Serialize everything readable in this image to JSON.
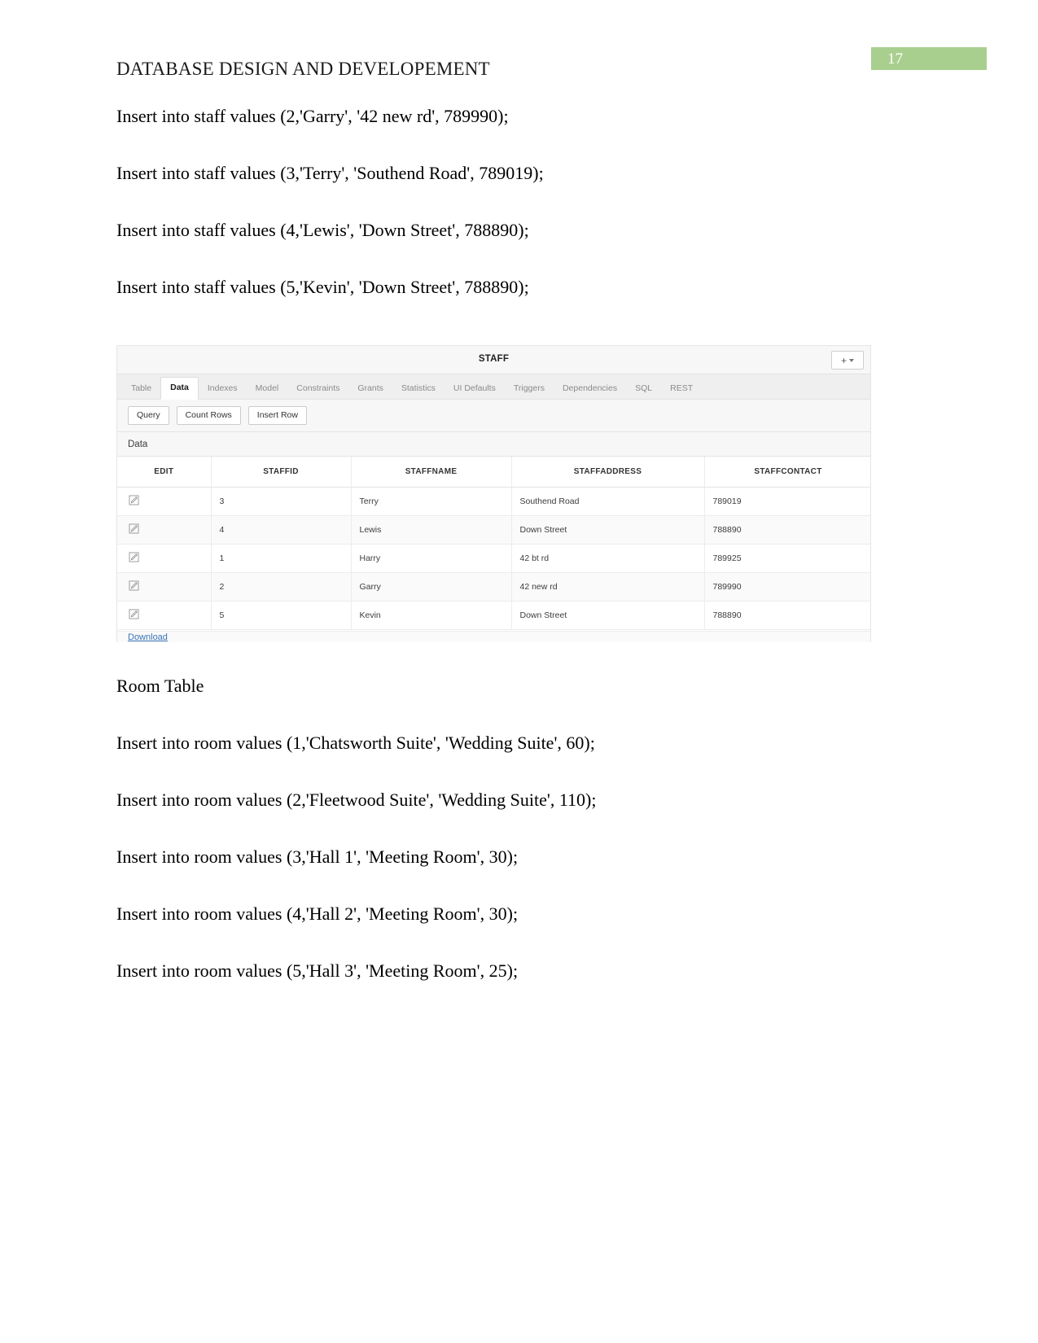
{
  "header": {
    "title": "DATABASE DESIGN AND DEVELOPEMENT",
    "page_number": "17",
    "badge_color": "#a9cf8f"
  },
  "body": {
    "staff_inserts": [
      "Insert into staff values (2,'Garry', '42 new rd', 789990);",
      "Insert into staff values (3,'Terry', 'Southend Road', 789019);",
      "Insert into staff values (4,'Lewis', 'Down Street', 788890);",
      "Insert into staff values (5,'Kevin', 'Down Street', 788890);"
    ],
    "room_heading": "Room Table",
    "room_inserts": [
      "Insert into room values (1,'Chatsworth Suite', 'Wedding Suite', 60);",
      "Insert into room values (2,'Fleetwood Suite', 'Wedding Suite', 110);",
      "Insert into room values (3,'Hall 1', 'Meeting Room', 30);",
      "Insert into room values (4,'Hall 2', 'Meeting Room', 30);",
      "Insert into room values (5,'Hall 3', 'Meeting Room', 25);"
    ]
  },
  "apex": {
    "title": "STAFF",
    "add_button_label": "+",
    "tabs": [
      {
        "label": "Table",
        "active": false
      },
      {
        "label": "Data",
        "active": true
      },
      {
        "label": "Indexes",
        "active": false
      },
      {
        "label": "Model",
        "active": false
      },
      {
        "label": "Constraints",
        "active": false
      },
      {
        "label": "Grants",
        "active": false
      },
      {
        "label": "Statistics",
        "active": false
      },
      {
        "label": "UI Defaults",
        "active": false
      },
      {
        "label": "Triggers",
        "active": false
      },
      {
        "label": "Dependencies",
        "active": false
      },
      {
        "label": "SQL",
        "active": false
      },
      {
        "label": "REST",
        "active": false
      }
    ],
    "buttons": [
      "Query",
      "Count Rows",
      "Insert Row"
    ],
    "section_label": "Data",
    "columns": [
      "EDIT",
      "STAFFID",
      "STAFFNAME",
      "STAFFADDRESS",
      "STAFFCONTACT"
    ],
    "rows": [
      {
        "edit": "edit-icon",
        "staffid": "3",
        "staffname": "Terry",
        "staffaddress": "Southend Road",
        "staffcontact": "789019"
      },
      {
        "edit": "edit-icon",
        "staffid": "4",
        "staffname": "Lewis",
        "staffaddress": "Down Street",
        "staffcontact": "788890"
      },
      {
        "edit": "edit-icon",
        "staffid": "1",
        "staffname": "Harry",
        "staffaddress": "42 bt rd",
        "staffcontact": "789925"
      },
      {
        "edit": "edit-icon",
        "staffid": "2",
        "staffname": "Garry",
        "staffaddress": "42 new rd",
        "staffcontact": "789990"
      },
      {
        "edit": "edit-icon",
        "staffid": "5",
        "staffname": "Kevin",
        "staffaddress": "Down Street",
        "staffcontact": "788890"
      }
    ],
    "download_label": "Download"
  }
}
